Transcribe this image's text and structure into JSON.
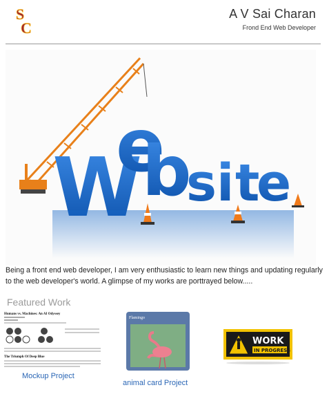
{
  "header": {
    "logo_text": "SC",
    "name": "A V Sai Charan",
    "role": "Frond End Web Developer"
  },
  "hero": {
    "word": "Website"
  },
  "intro": {
    "text": "Being a front end web developer, I am very enthusiastic to learn new things and updating regularly to the web developer's world. A glimpse of my works are porttrayed below....."
  },
  "featured": {
    "title": "Featured Work",
    "projects": [
      {
        "label": "Mockup Project",
        "doc_title": "Humans vs. Machines: An AI Odyssey",
        "doc_subtitle": "The Triumph Of Deep Blue"
      },
      {
        "label": "animal card Project",
        "card_title": "Flamingo"
      },
      {
        "label": "",
        "sign_text": [
          "WORK",
          "IN PROGRESS"
        ]
      }
    ]
  },
  "colors": {
    "logo_red": "#9d2235",
    "logo_gold": "#ffc72c",
    "link_blue": "#2a66b5",
    "muted_gray": "#9b9b9b",
    "hero_blue": "#1466c6",
    "crane_orange": "#f08a1f"
  }
}
